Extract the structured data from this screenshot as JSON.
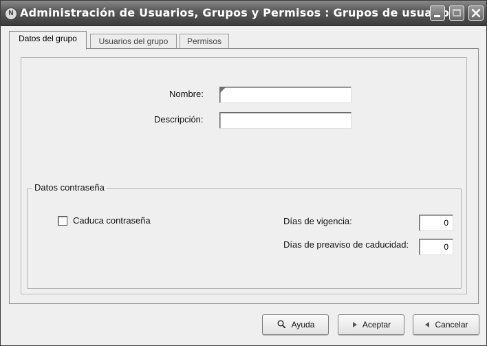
{
  "window": {
    "title": "Administración de Usuarios, Grupos y Permisos : Grupos de usuarios",
    "app_icon_glyph": "N"
  },
  "tabs": [
    {
      "label": "Datos del grupo",
      "active": true
    },
    {
      "label": "Usuarios del grupo",
      "active": false
    },
    {
      "label": "Permisos",
      "active": false
    }
  ],
  "form": {
    "nombre_label": "Nombre:",
    "nombre_value": "",
    "descripcion_label": "Descripción:",
    "descripcion_value": ""
  },
  "password_group": {
    "legend": "Datos contraseña",
    "caduca_label": "Caduca contraseña",
    "caduca_checked": false,
    "vigencia_label": "Días de vigencia:",
    "vigencia_value": "0",
    "preaviso_label": "Días de preaviso de caducidad:",
    "preaviso_value": "0"
  },
  "buttons": {
    "ayuda": "Ayuda",
    "aceptar": "Aceptar",
    "cancelar": "Cancelar"
  },
  "icons": {
    "app": "app-logo-icon",
    "minimize": "minimize-icon",
    "maximize": "maximize-icon",
    "close": "close-icon",
    "help": "help-icon",
    "accept": "play-arrow-icon",
    "cancel": "back-arrow-icon"
  }
}
